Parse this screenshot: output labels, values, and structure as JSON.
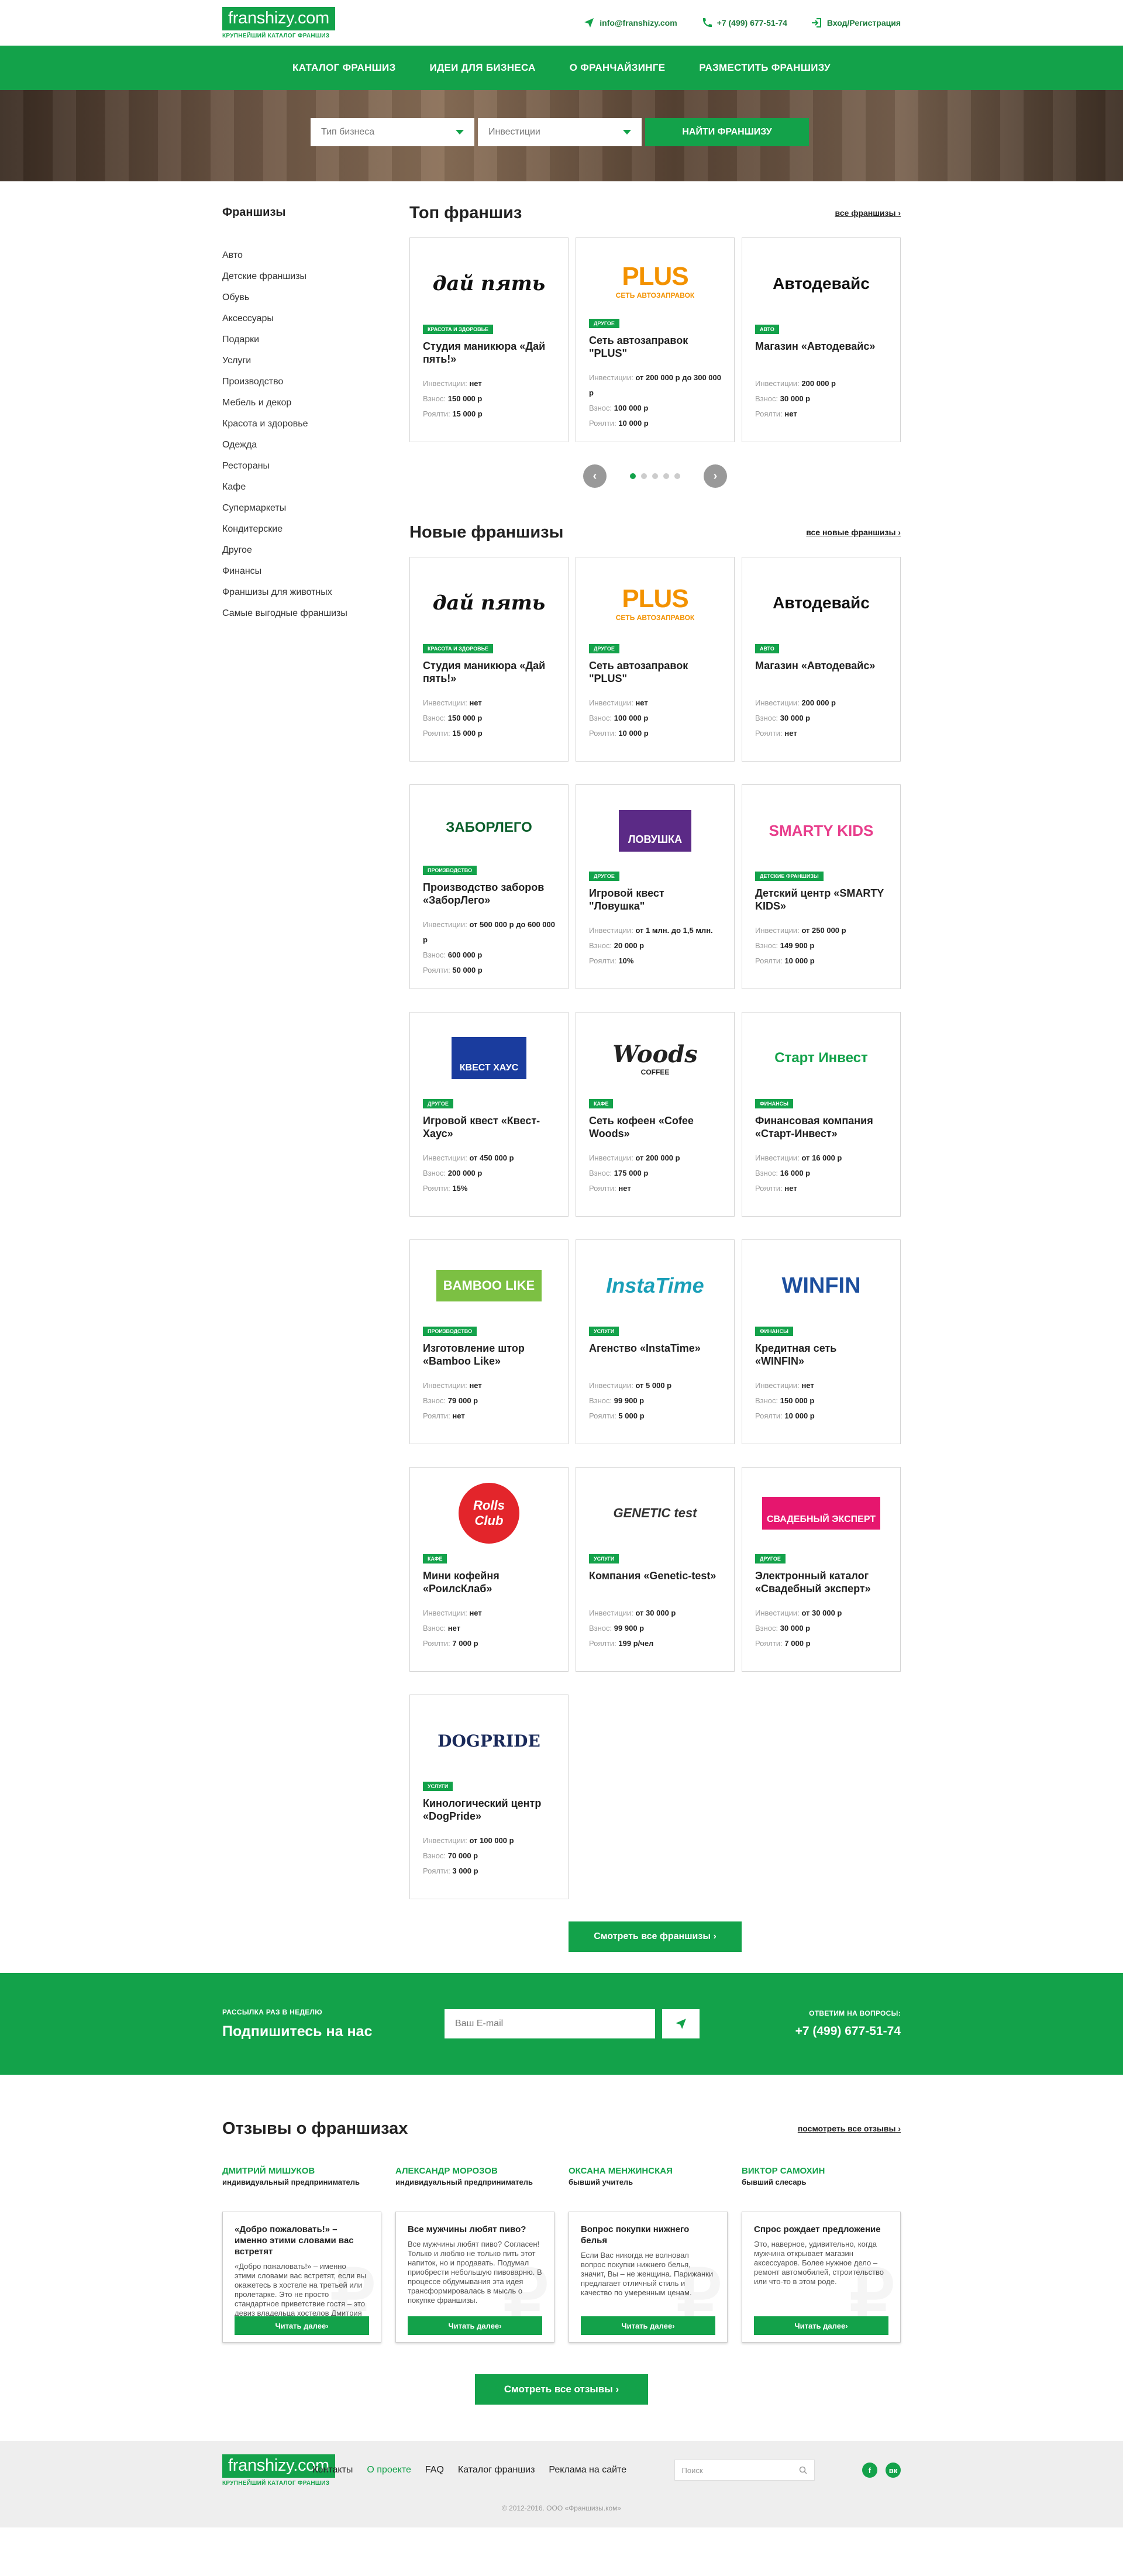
{
  "header": {
    "logo": "franshizy.com",
    "logo_sub": "КРУПНЕЙШИЙ КАТАЛОГ ФРАНШИЗ",
    "email": "info@franshizy.com",
    "phone": "+7 (499) 677-51-74",
    "login": "Вход/Регистрация"
  },
  "nav": [
    "КАТАЛОГ ФРАНШИЗ",
    "ИДЕИ ДЛЯ БИЗНЕСА",
    "О ФРАНЧАЙЗИНГЕ",
    "РАЗМЕСТИТЬ ФРАНШИЗУ"
  ],
  "search": {
    "type": "Тип бизнеса",
    "invest": "Инвестиции",
    "button": "НАЙТИ ФРАНШИЗУ"
  },
  "sidebar": {
    "title": "Франшизы",
    "items": [
      "Авто",
      "Детские франшизы",
      "Обувь",
      "Аксессуары",
      "Подарки",
      "Услуги",
      "Производство",
      "Мебель и декор",
      "Красота и здоровье",
      "Одежда",
      "Рестораны",
      "Кафе",
      "Супермаркеты",
      "Кондитерские",
      "Другое",
      "Финансы",
      "Франшизы для животных",
      "Самые выгодные франшизы"
    ]
  },
  "labels": {
    "invest": "Инвестиции:",
    "fee": "Взнос:",
    "royalty": "Роялти:"
  },
  "top": {
    "title": "Топ франшиз",
    "all": "все франшизы",
    "cards": [
      {
        "logo": "дай пять",
        "cat": "КРАСОТА И ЗДОРОВЬЕ",
        "name": "Студия маникюра «Дай пять!»",
        "invest": "нет",
        "fee": "150 000 р",
        "royalty": "15 000 р"
      },
      {
        "logo": "PLUS",
        "logo_sub": "СЕТЬ АВТОЗАПРАВОК",
        "cat": "ДРУГОЕ",
        "name": "Сеть автозаправок \"PLUS\"",
        "invest": "от 200 000 р до 300 000 р",
        "fee": "100 000 р",
        "royalty": "10 000 р"
      },
      {
        "logo": "Автодевайс",
        "cat": "АВТО",
        "name": "Магазин «Автодевайс»",
        "invest": "200 000 р",
        "fee": "30 000 р",
        "royalty": "нет"
      }
    ]
  },
  "new": {
    "title": "Новые франшизы",
    "all": "все новые франшизы",
    "cards": [
      {
        "logo": "дай пять",
        "cat": "КРАСОТА И ЗДОРОВЬЕ",
        "name": "Студия маникюра «Дай пять!»",
        "invest": "нет",
        "fee": "150 000 р",
        "royalty": "15 000 р"
      },
      {
        "logo": "PLUS",
        "logo_sub": "СЕТЬ АВТОЗАПРАВОК",
        "cat": "ДРУГОЕ",
        "name": "Сеть автозаправок \"PLUS\"",
        "invest": "нет",
        "fee": "100 000 р",
        "royalty": "10 000 р"
      },
      {
        "logo": "Автодевайс",
        "cat": "АВТО",
        "name": "Магазин «Автодевайс»",
        "invest": "200 000 р",
        "fee": "30 000 р",
        "royalty": "нет"
      },
      {
        "logo": "ЗАБОРЛЕГО",
        "cat": "ПРОИЗВОДСТВО",
        "name": "Производство заборов «ЗаборЛего»",
        "invest": "от 500 000 р до 600 000 р",
        "fee": "600 000 р",
        "royalty": "50 000 р"
      },
      {
        "logo": "ЛОВУШКА",
        "cat": "ДРУГОЕ",
        "name": "Игровой квест \"Ловушка\"",
        "invest": "от 1 млн. до 1,5 млн.",
        "fee": "20 000 р",
        "royalty": "10%"
      },
      {
        "logo": "SMARTY KIDS",
        "cat": "ДЕТСКИЕ ФРАНШИЗЫ",
        "name": "Детский центр «SMARTY KIDS»",
        "invest": "от 250 000 р",
        "fee": "149 900 р",
        "royalty": "10 000 р"
      },
      {
        "logo": "КВЕСТ ХАУС",
        "cat": "ДРУГОЕ",
        "name": "Игровой квест «Квест-Хаус»",
        "invest": "от 450 000 р",
        "fee": "200 000 р",
        "royalty": "15%"
      },
      {
        "logo": "Woods",
        "logo_sub": "COFFEE",
        "cat": "КАФЕ",
        "name": "Сеть кофеен «Cofee Woods»",
        "invest": "от 200 000 р",
        "fee": "175 000 р",
        "royalty": "нет"
      },
      {
        "logo": "Старт Инвест",
        "cat": "ФИНАНСЫ",
        "name": "Финансовая компания «Старт-Инвест»",
        "invest": "от 16 000 р",
        "fee": "16 000 р",
        "royalty": "нет"
      },
      {
        "logo": "BAMBOO LIKE",
        "cat": "ПРОИЗВОДСТВО",
        "name": "Изготовление штор «Bamboo Like»",
        "invest": "нет",
        "fee": "79 000 р",
        "royalty": "нет"
      },
      {
        "logo": "InstaTime",
        "cat": "УСЛУГИ",
        "name": "Агенство «InstaTime»",
        "invest": "от 5 000 р",
        "fee": "99 900 р",
        "royalty": "5 000 р"
      },
      {
        "logo": "WINFIN",
        "cat": "ФИНАНСЫ",
        "name": "Кредитная сеть «WINFIN»",
        "invest": "нет",
        "fee": "150 000 р",
        "royalty": "10 000 р"
      },
      {
        "logo": "Rolls Club",
        "cat": "КАФЕ",
        "name": "Мини кофейня «РоилсКлаб»",
        "invest": "нет",
        "fee": "нет",
        "royalty": "7 000 р"
      },
      {
        "logo": "GENETIC test",
        "cat": "УСЛУГИ",
        "name": "Компания «Genetic-test»",
        "invest": "от 30 000 р",
        "fee": "99 900 р",
        "royalty": "199 р/чел"
      },
      {
        "logo": "СВАДЕБНЫЙ ЭКСПЕРТ",
        "cat": "ДРУГОЕ",
        "name": "Электронный каталог «Свадебный эксперт»",
        "invest": "от 30 000 р",
        "fee": "30 000 р",
        "royalty": "7 000 р"
      },
      {
        "logo": "DOGPRIDE",
        "cat": "УСЛУГИ",
        "name": "Кинологический центр «DogPride»",
        "invest": "от 100 000 р",
        "fee": "70 000 р",
        "royalty": "3 000 р"
      }
    ],
    "more": "Смотреть все франшизы"
  },
  "subscribe": {
    "label": "РАССЫЛКА РАЗ В НЕДЕЛЮ",
    "title": "Подпишитесь на нас",
    "placeholder": "Ваш E-mail",
    "q_label": "ОТВЕТИМ НА ВОПРОСЫ:",
    "phone": "+7 (499) 677-51-74"
  },
  "reviews": {
    "title": "Отзывы о франшизах",
    "all": "посмотреть все отзывы",
    "items": [
      {
        "author": "ДМИТРИЙ МИШУКОВ",
        "role": "индивидуальный предприниматель",
        "q": "«Добро пожаловать!» – именно этими словами вас встретят",
        "t": "«Добро пожаловать!» – именно этими словами вас встретят, если вы окажетесь в хостеле на третьей или пролетарке. Это не просто стандартное приветствие гостя – это девиз владельца хостелов Дмитрия Мишукова.",
        "btn": "Читать далее"
      },
      {
        "author": "АЛЕКСАНДР МОРОЗОВ",
        "role": "индивидуальный предприниматель",
        "q": "Все мужчины любят пиво?",
        "t": "Все мужчины любят пиво? Согласен! Только и люблю не только пить этот напиток, но и продавать. Подумал приобрести небольшую пивоварню. В процессе обдумывания эта идея трансформировалась в мысль о покупке франшизы.",
        "btn": "Читать далее"
      },
      {
        "author": "ОКСАНА МЕНЖИНСКАЯ",
        "role": "бывший учитель",
        "q": "Вопрос покупки нижнего белья",
        "t": "Если Вас никогда не волновал вопрос покупки нижнего белья, значит, Вы – не женщина. Парижанки предлагает отличный стиль и качество по умеренным ценам.",
        "btn": "Читать далее"
      },
      {
        "author": "ВИКТОР САМОХИН",
        "role": "бывший слесарь",
        "q": "Спрос рождает предложение",
        "t": "Это, наверное, удивительно, когда мужчина открывает магазин аксессуаров. Более нужное дело – ремонт автомобилей, строительство или что-то в этом роде.",
        "btn": "Читать далее"
      }
    ],
    "more": "Смотреть все отзывы"
  },
  "footer": {
    "links": [
      "Контакты",
      "О проекте",
      "FAQ",
      "Каталог франшиз",
      "Реклама на сайте"
    ],
    "search": "Поиск",
    "copy": "© 2012-2016. ООО «Франшизы.ком»",
    "social": [
      "f",
      "вк"
    ]
  }
}
